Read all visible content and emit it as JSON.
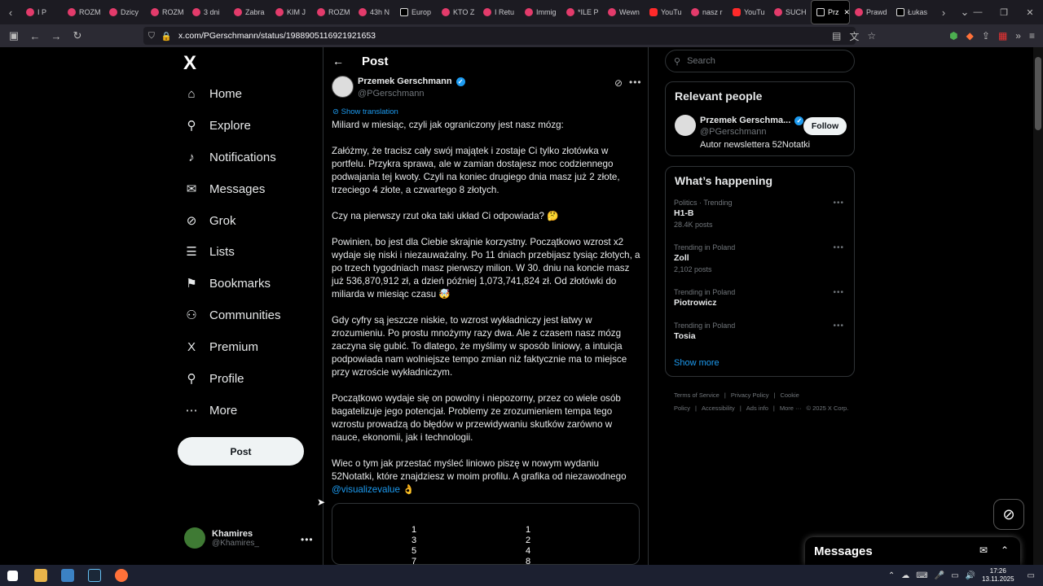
{
  "browser": {
    "tabs": [
      {
        "label": "I P",
        "kind": "pink"
      },
      {
        "label": "ROZM",
        "kind": "pink"
      },
      {
        "label": "Dzicy",
        "kind": "pink"
      },
      {
        "label": "ROZM",
        "kind": "pink"
      },
      {
        "label": "3 dni",
        "kind": "pink"
      },
      {
        "label": "Zabra",
        "kind": "pink"
      },
      {
        "label": "KIM J",
        "kind": "pink"
      },
      {
        "label": "ROZM",
        "kind": "pink"
      },
      {
        "label": "43h N",
        "kind": "pink"
      },
      {
        "label": "Europ",
        "kind": "x"
      },
      {
        "label": "KTO Z",
        "kind": "pink"
      },
      {
        "label": "I Retu",
        "kind": "pink"
      },
      {
        "label": "Immig",
        "kind": "pink"
      },
      {
        "label": "*ILE P",
        "kind": "pink"
      },
      {
        "label": "Wewn",
        "kind": "pink"
      },
      {
        "label": "YouTu",
        "kind": "yt"
      },
      {
        "label": "nasz r",
        "kind": "pink"
      },
      {
        "label": "YouTu",
        "kind": "yt"
      },
      {
        "label": "SUCH",
        "kind": "pink"
      },
      {
        "label": "Prz",
        "kind": "x",
        "active": true
      },
      {
        "label": "Prawd",
        "kind": "pink"
      },
      {
        "label": "Łukas",
        "kind": "x"
      }
    ],
    "url": "x.com/PGerschmann/status/1988905116921921653"
  },
  "sidebar": {
    "logo": "X",
    "items": [
      {
        "label": "Home",
        "icon": "⌂"
      },
      {
        "label": "Explore",
        "icon": "⚲"
      },
      {
        "label": "Notifications",
        "icon": "♪"
      },
      {
        "label": "Messages",
        "icon": "✉"
      },
      {
        "label": "Grok",
        "icon": "⊘"
      },
      {
        "label": "Lists",
        "icon": "☰"
      },
      {
        "label": "Bookmarks",
        "icon": "⚑"
      },
      {
        "label": "Communities",
        "icon": "⚇"
      },
      {
        "label": "Premium",
        "icon": "X"
      },
      {
        "label": "Profile",
        "icon": "⚲"
      },
      {
        "label": "More",
        "icon": "⋯"
      }
    ],
    "post_button": "Post",
    "account": {
      "name": "Khamires",
      "handle": "@Khamires_"
    }
  },
  "post": {
    "header_title": "Post",
    "author_name": "Przemek Gerschmann",
    "author_handle": "@PGerschmann",
    "show_translation": "Show translation",
    "paragraphs": [
      "Miliard w miesiąc, czyli jak ograniczony jest nasz mózg:",
      "Załóżmy, że tracisz cały swój majątek i zostaje Ci tylko złotówka w portfelu. Przykra sprawa, ale w zamian dostajesz moc codziennego podwajania tej kwoty. Czyli na koniec drugiego dnia masz już 2 złote, trzeciego 4 złote, a czwartego 8 złotych.",
      "Czy na pierwszy rzut oka taki układ Ci odpowiada? 🤔",
      "Powinien, bo jest dla Ciebie skrajnie korzystny. Początkowo wzrost x2 wydaje się niski i niezauważalny. Po 11 dniach przebijasz tysiąc złotych, a po trzech tygodniach masz pierwszy milion. W 30. dniu na koncie masz już 536,870,912 zł, a dzień później 1,073,741,824 zł. Od złotówki do miliarda w miesiąc czasu 🤯",
      "Gdy cyfry są jeszcze niskie, to wzrost wykładniczy jest łatwy w zrozumieniu. Po prostu mnożymy razy dwa. Ale z czasem nasz mózg zaczyna się gubić. To dlatego, że myślimy w sposób liniowy, a intuicja podpowiada nam wolniejsze tempo zmian niż faktycznie ma to miejsce przy wzroście wykładniczym.",
      "Początkowo wydaje się on powolny i niepozorny, przez co wiele osób bagatelizuje jego potencjał. Problemy ze zrozumieniem tempa tego wzrostu prowadzą do błędów w przewidywaniu skutków zarówno w nauce, ekonomii, jak i technologii."
    ],
    "last_paragraph": "Wiec o tym jak przestać myśleć liniowo piszę w nowym wydaniu 52Notatki, które znajdziesz w moim profilu. A grafika od niezawodnego ",
    "mention": "@visualizevalue",
    "last_emoji": " 👌",
    "media": {
      "left_column": [
        "1",
        "3",
        "5",
        "7"
      ],
      "right_column": [
        "1",
        "2",
        "4",
        "8"
      ]
    }
  },
  "right": {
    "search_placeholder": "Search",
    "relevant_title": "Relevant people",
    "relevant_person": {
      "name": "Przemek Gerschma...",
      "handle": "@PGerschmann",
      "bio": "Autor newslettera 52Notatki",
      "follow": "Follow"
    },
    "happening_title": "What’s happening",
    "trends": [
      {
        "context": "Politics · Trending",
        "title": "H1-B",
        "count": "28.4K posts"
      },
      {
        "context": "Trending in Poland",
        "title": "Zoll",
        "count": "2,102 posts"
      },
      {
        "context": "Trending in Poland",
        "title": "Piotrowicz",
        "count": ""
      },
      {
        "context": "Trending in Poland",
        "title": "Tosia",
        "count": ""
      }
    ],
    "show_more": "Show more",
    "footer": [
      "Terms of Service",
      "|",
      "Privacy Policy",
      "|",
      "Cookie Policy",
      "|",
      "Accessibility",
      "|",
      "Ads info",
      "|",
      "More ···",
      "© 2025 X Corp."
    ]
  },
  "messages_drawer": {
    "title": "Messages"
  },
  "taskbar": {
    "time": "17:26",
    "date": "13.11.2025"
  },
  "colors": {
    "accent": "#1d9bf0",
    "background": "#000000",
    "border": "#2f3336"
  }
}
